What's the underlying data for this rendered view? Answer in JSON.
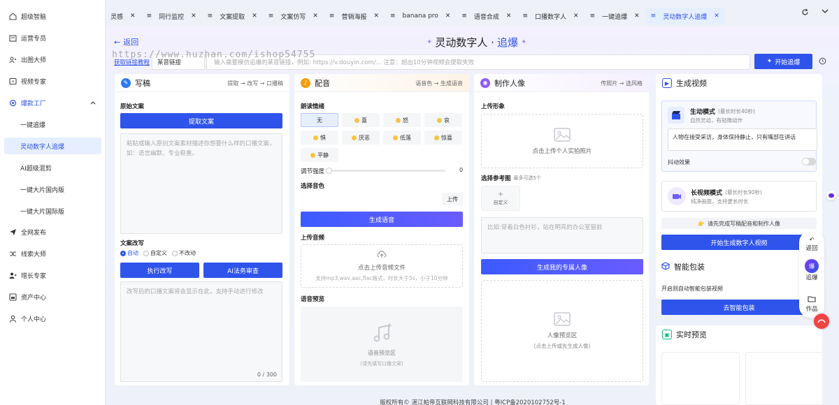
{
  "sidebar": {
    "items": [
      {
        "label": "超级智脑",
        "icon": "home-icon"
      },
      {
        "label": "运营专员",
        "icon": "calendar-icon"
      },
      {
        "label": "出图大师",
        "icon": "people-icon"
      },
      {
        "label": "视频专家",
        "icon": "video-icon"
      },
      {
        "label": "爆款工厂",
        "icon": "gear-icon"
      },
      {
        "label": "一键追爆"
      },
      {
        "label": "灵动数字人追爆"
      },
      {
        "label": "AI超级混剪"
      },
      {
        "label": "一键大片国内版"
      },
      {
        "label": "一键大片国际版"
      },
      {
        "label": "全网发布",
        "icon": "send-icon"
      },
      {
        "label": "线索大师",
        "icon": "shuffle-icon"
      },
      {
        "label": "增长专家",
        "icon": "user-plus-icon"
      },
      {
        "label": "资产中心",
        "icon": "box-icon"
      },
      {
        "label": "个人中心",
        "icon": "user-icon"
      }
    ]
  },
  "tabs": [
    "灵感",
    "同行监控",
    "文案提取",
    "文案仿写",
    "营销海报",
    "banana pro",
    "语音合成",
    "口播数字人",
    "一键追爆",
    "灵动数字人追爆"
  ],
  "header": {
    "back": "返回",
    "title_main": "灵动数字人 · ",
    "title_hl": "追爆",
    "link_text": "获取链接教程",
    "select_value": "某音链接",
    "url_placeholder": "输入需要模仿追爆的某音链接，例如: https://v.douyin.com/... 注意：超出10分钟视频会提取失败",
    "start_button": "开始追爆"
  },
  "watermark": "https://www.huzhan.com/ishop54755",
  "script": {
    "title": "写稿",
    "steps": "提取 → 改写 → 口播稿",
    "original_label": "原始文案",
    "extract_button": "提取文案",
    "original_placeholder": "粘贴或输入原创文案素材描述你想要什么样的口播文案，如：语言幽默、专业稳重。",
    "rewrite_label": "文案改写",
    "radio_options": [
      "自动",
      "自定义",
      "不改动"
    ],
    "exec_button": "执行改写",
    "ai_button": "AI法务审查",
    "rewrite_placeholder": "改写后的口播文案将会显示在此，支持手动进行修改",
    "counter": "0 / 300"
  },
  "voice": {
    "title": "配音",
    "steps": "语音色 → 生成语音",
    "emotion_label": "朗读情绪",
    "emotions": [
      "无",
      "喜",
      "怒",
      "哀",
      "惧",
      "厌恶",
      "低落",
      "惊喜",
      "平静"
    ],
    "intensity_label": "调节强度",
    "intensity_value": "0",
    "timbre_label": "选择音色",
    "upload_small": "上传",
    "gen_button": "生成语音",
    "upload_audio_label": "上传音频",
    "upload_audio_text": "点击上传音频文件",
    "upload_audio_hint": "支持mp3,wav,aac,flac格式，时长大于5s，小于10分钟",
    "preview_label": "语音预览",
    "preview_area": "语音预览区",
    "preview_hint": "(请先填写口播文案)"
  },
  "portrait": {
    "title": "制作人像",
    "steps": "传照片 → 选风格",
    "upload_label": "上传形象",
    "upload_text": "点击上传个人实拍照片",
    "ref_label": "选择参考图",
    "ref_hint": "最多可选5个",
    "custom": "自定义",
    "desc_placeholder": "比如:穿着白色衬衫，站在明亮的办公室窗前",
    "gen_button": "生成我的专属人像",
    "preview_area": "人像预览区",
    "preview_hint": "(点击上传或先生成人像)"
  },
  "video": {
    "title": "生成视频",
    "mode1_title": "生动模式",
    "mode1_sub": "(最长时长40秒)",
    "mode1_desc": "自然灵动，有轻微动作",
    "mode1_input": "人物在接受采访，身体保持静止，只有嘴部在讲话",
    "shake_label": "抖动效果",
    "mode2_title": "长视频模式",
    "mode2_sub": "(最长时长90秒)",
    "mode2_desc": "纯净画面，支持更长时长",
    "notice": "请先完成写稿配音和制作人像",
    "gen_button": "开始生成数字人视频",
    "pack_title": "智能包装",
    "pack_desc": "开启则自动智能包装视频",
    "pack_button": "去智能包装",
    "live_title": "实时预览"
  },
  "float": {
    "back": "返回",
    "chase": "追爆",
    "works": "作品"
  },
  "footer": "版权所有© 湛江帕帝互联网科技有限公司 | 粤ICP备2020102752号-1"
}
